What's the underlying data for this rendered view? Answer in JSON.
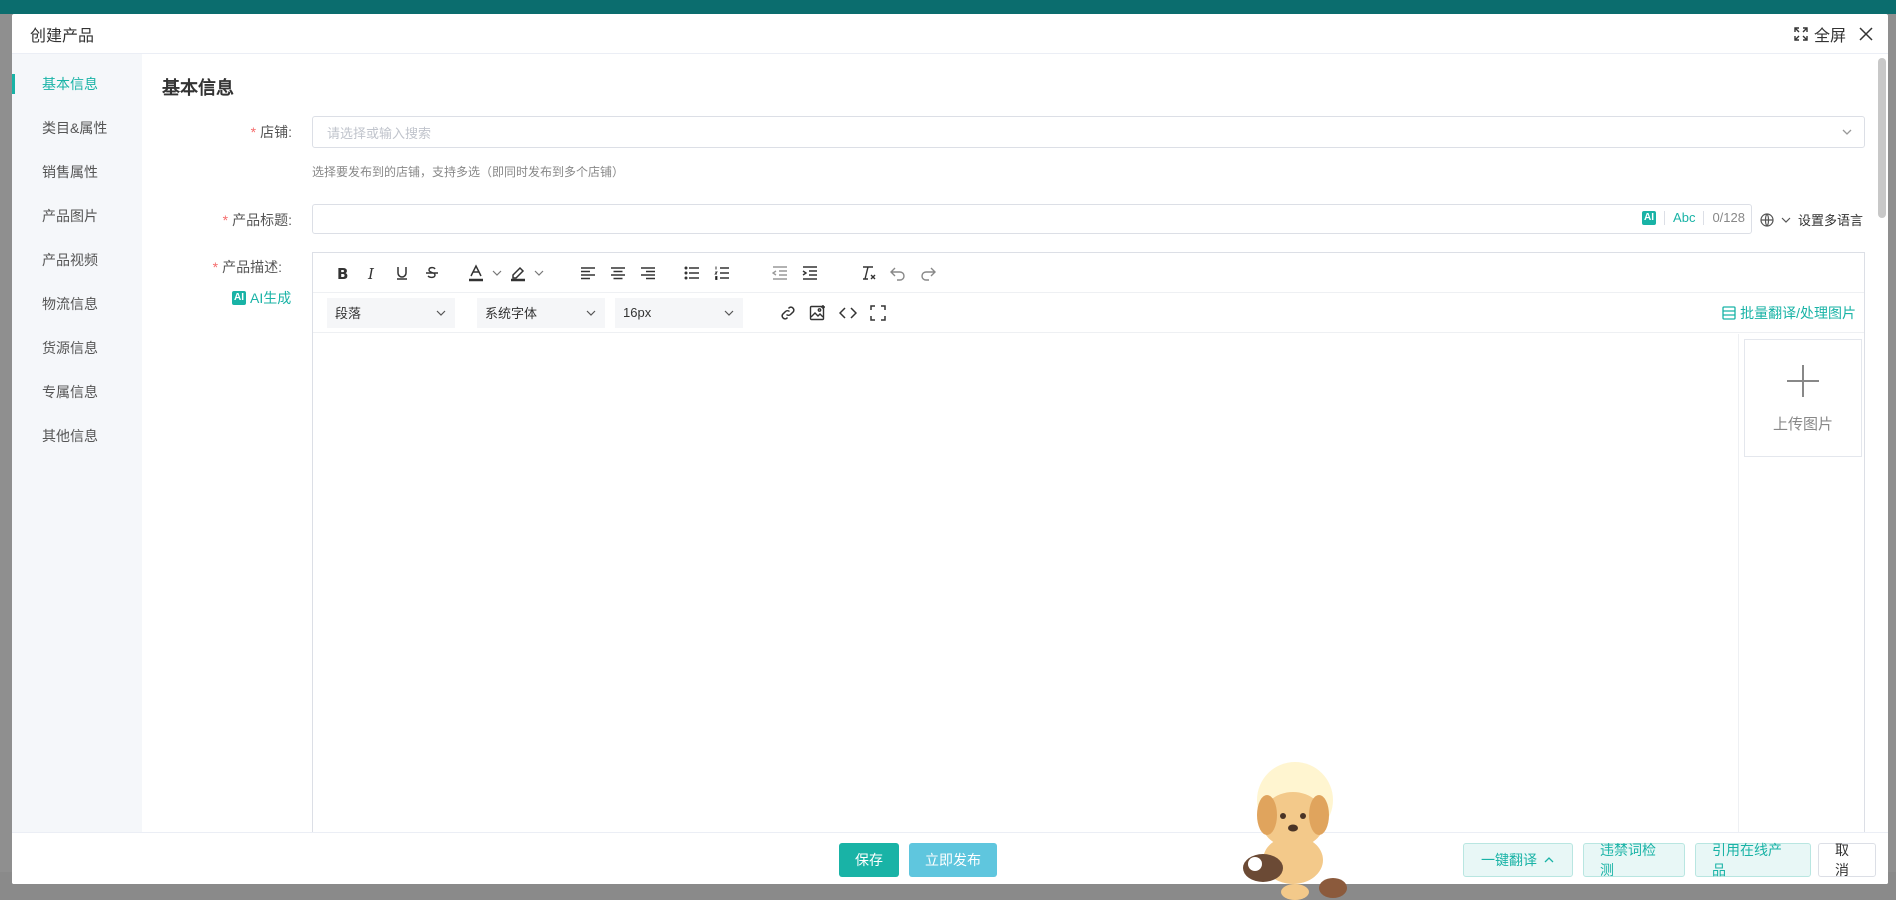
{
  "modal": {
    "title": "创建产品",
    "fullscreen_label": "全屏"
  },
  "side_nav": {
    "items": [
      {
        "label": "基本信息",
        "active": true
      },
      {
        "label": "类目&属性"
      },
      {
        "label": "销售属性"
      },
      {
        "label": "产品图片"
      },
      {
        "label": "产品视频"
      },
      {
        "label": "物流信息"
      },
      {
        "label": "货源信息"
      },
      {
        "label": "专属信息"
      },
      {
        "label": "其他信息"
      }
    ]
  },
  "form": {
    "section_title": "基本信息",
    "shop": {
      "label": "店铺:",
      "placeholder": "请选择或输入搜索",
      "hint": "选择要发布到的店铺，支持多选（即同时发布到多个店铺）"
    },
    "product_title": {
      "label": "产品标题:",
      "ai_badge": "AI",
      "abc": "Abc",
      "count": "0/128",
      "multi_lang": "设置多语言"
    },
    "description": {
      "label": "产品描述:",
      "ai_generate": "AI生成",
      "paragraph_select": "段落",
      "font_select": "系统字体",
      "size_select": "16px",
      "batch_translate": "批量翻译/处理图片",
      "upload_label": "上传图片"
    }
  },
  "footer": {
    "save": "保存",
    "publish": "立即发布",
    "translate": "一键翻译",
    "check": "违禁词检测",
    "online": "引用在线产品",
    "cancel": "取消"
  },
  "colors": {
    "accent": "#19b3a6",
    "publish": "#5fc6de",
    "required": "#f56c6c"
  }
}
